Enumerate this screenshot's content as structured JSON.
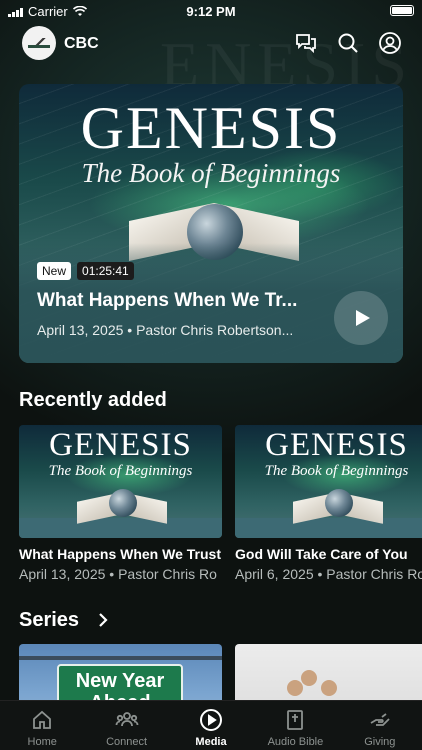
{
  "status_bar": {
    "carrier": "Carrier",
    "time": "9:12 PM"
  },
  "header": {
    "brand": "CBC",
    "icons": [
      "chat-bubbles-icon",
      "search-icon",
      "account-icon"
    ]
  },
  "hero": {
    "art_title": "GENESIS",
    "art_subtitle": "The Book of Beginnings",
    "badge_new": "New",
    "duration": "01:25:41",
    "episode_title": "What Happens When We Tr...",
    "meta": "April 13, 2025 • Pastor Chris Robertson..."
  },
  "recently_added": {
    "title": "Recently added",
    "items": [
      {
        "art_title": "GENESIS",
        "art_subtitle": "The Book of Beginnings",
        "title": "What Happens When We Trust",
        "meta": "April 13, 2025 • Pastor Chris Ro"
      },
      {
        "art_title": "GENESIS",
        "art_subtitle": "The Book of Beginnings",
        "title": "God Will Take Care of You",
        "meta": "April 6, 2025 • Pastor Chris Ro"
      }
    ]
  },
  "series": {
    "title": "Series",
    "items": [
      {
        "sign_text": "New Year Ahead"
      },
      {
        "sign_text": ""
      }
    ]
  },
  "tab_bar": {
    "items": [
      {
        "label": "Home",
        "icon": "home-icon"
      },
      {
        "label": "Connect",
        "icon": "group-icon"
      },
      {
        "label": "Media",
        "icon": "play-circle-icon",
        "active": true
      },
      {
        "label": "Audio Bible",
        "icon": "bible-icon"
      },
      {
        "label": "Giving",
        "icon": "giving-hand-icon"
      }
    ]
  }
}
